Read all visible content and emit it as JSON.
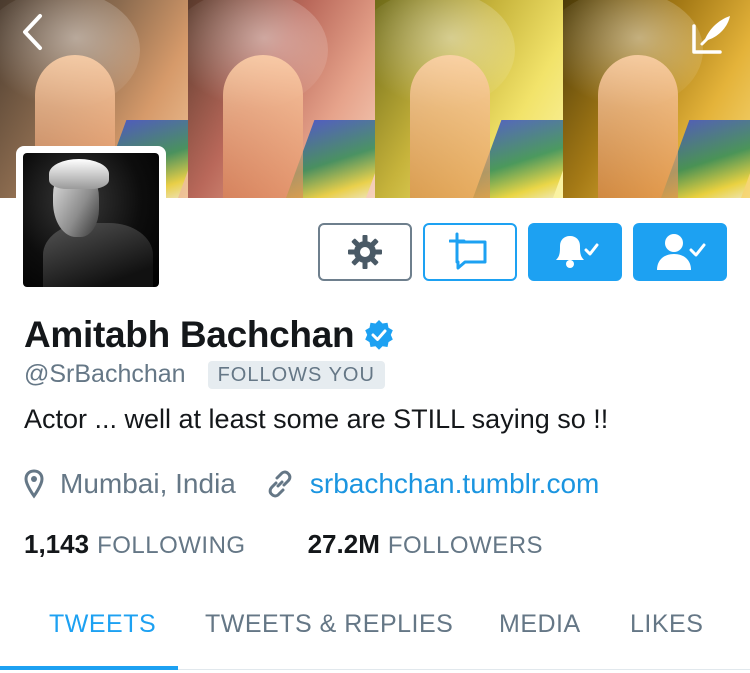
{
  "header": {
    "back_icon": "chevron-left-icon",
    "compose_icon": "compose-tweet-icon"
  },
  "profile": {
    "name": "Amitabh Bachchan",
    "verified": true,
    "handle": "@SrBachchan",
    "follows_you_badge": "FOLLOWS YOU",
    "bio": "Actor ... well at least some are STILL saying so !!",
    "location": "Mumbai, India",
    "website": "srbachchan.tumblr.com",
    "following_count": "1,143",
    "following_label": "FOLLOWING",
    "followers_count": "27.2M",
    "followers_label": "FOLLOWERS"
  },
  "actions": {
    "settings_icon": "gear-icon",
    "message_icon": "direct-message-icon",
    "notifications_icon": "bell-check-icon",
    "following_icon": "user-check-icon"
  },
  "tabs": [
    {
      "label": "TWEETS",
      "active": true
    },
    {
      "label": "TWEETS & REPLIES",
      "active": false
    },
    {
      "label": "MEDIA",
      "active": false
    },
    {
      "label": "LIKES",
      "active": false
    }
  ],
  "colors": {
    "accent": "#1da1f2",
    "link": "#1b95e0",
    "muted_text": "#657786",
    "badge_bg": "#e6ecf0"
  }
}
